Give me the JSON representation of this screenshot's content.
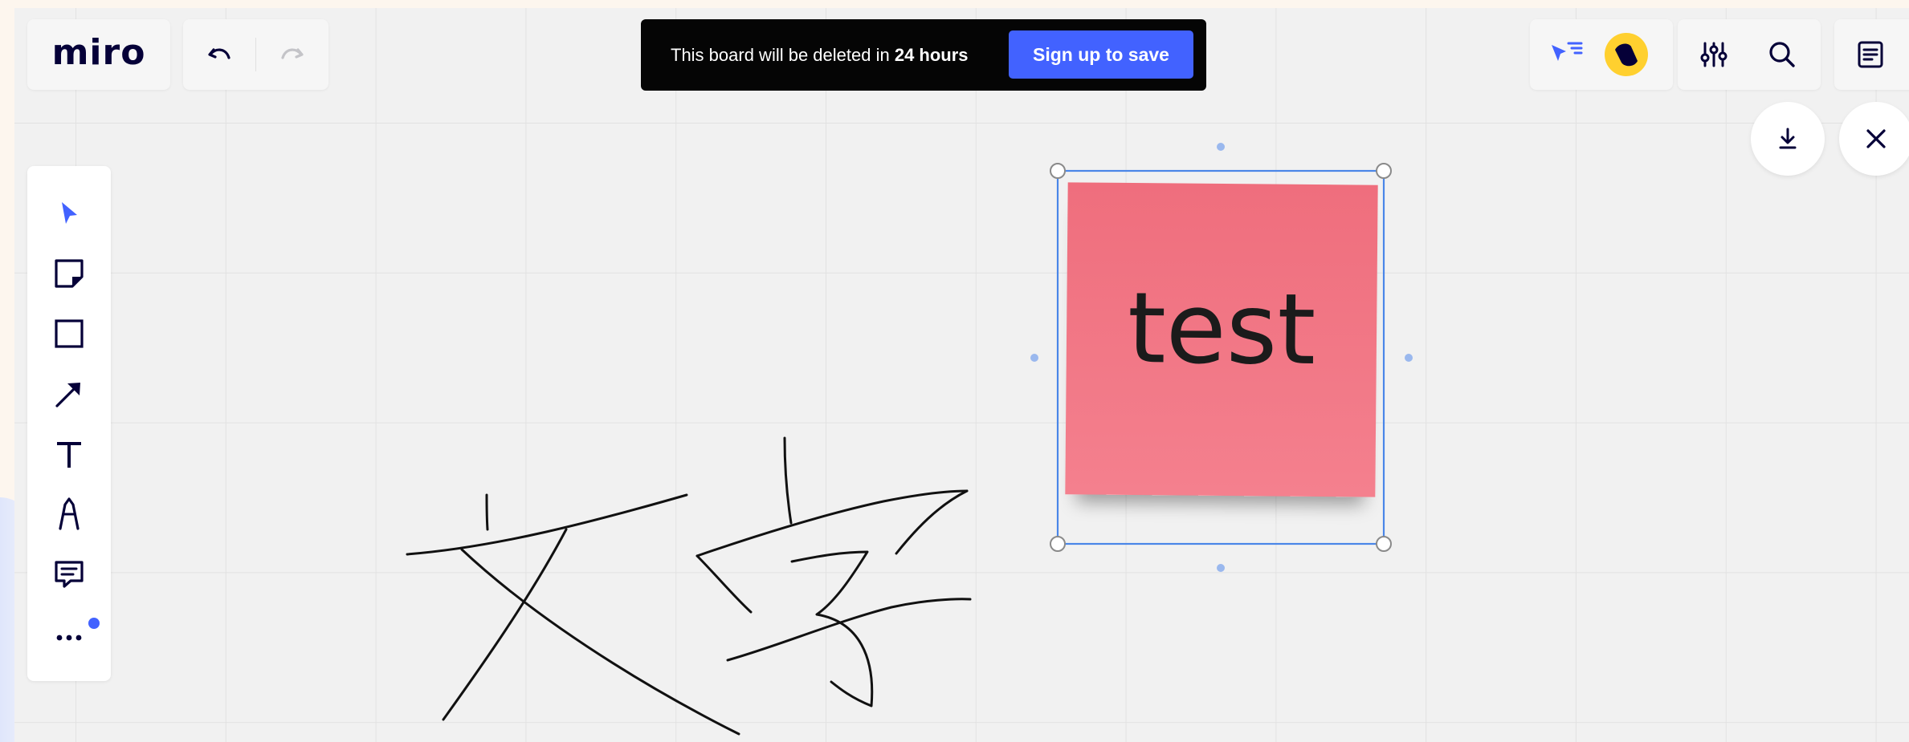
{
  "app": {
    "logo": "miro"
  },
  "history": {
    "undo_icon": "undo-icon",
    "redo_icon": "redo-icon"
  },
  "banner": {
    "text_prefix": "This board will be deleted in ",
    "text_bold": "24 hours",
    "button_label": "Sign up to save"
  },
  "header_right": {
    "icons": [
      "cursor-filter-icon",
      "avatar",
      "sliders-icon",
      "search-icon",
      "notes-icon"
    ],
    "avatar_color": "#ffd02f",
    "accent": "#4262ff"
  },
  "floating_actions": {
    "icons": [
      "download-icon",
      "close-icon"
    ]
  },
  "toolbar": {
    "tools": [
      "select-tool-icon",
      "sticky-note-icon",
      "rectangle-icon",
      "arrow-icon",
      "text-icon",
      "pen-icon",
      "comment-icon",
      "more-icon"
    ],
    "active_color": "#4262ff"
  },
  "canvas": {
    "sticky_note": {
      "text": "test",
      "color": "#f37584"
    },
    "selection_color": "#4a86e8",
    "handwriting_color": "#111111"
  }
}
